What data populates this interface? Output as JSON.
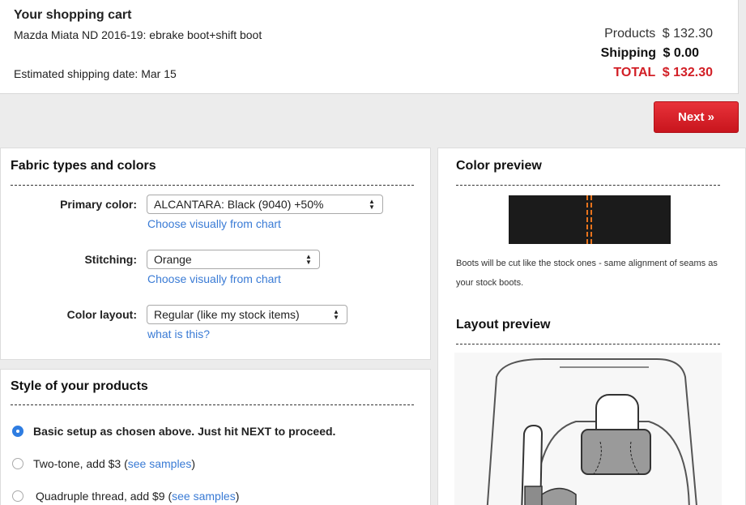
{
  "cart": {
    "title": "Your shopping cart",
    "product": "Mazda Miata ND 2016-19: ebrake boot+shift boot",
    "shipping_date": "Estimated shipping date: Mar 15",
    "products_label": "Products",
    "products_value": "$ 132.30",
    "shipping_label": "Shipping",
    "shipping_value": "$ 0.00",
    "total_label": "TOTAL",
    "total_value": "$ 132.30"
  },
  "next_button": "Next »",
  "fabric": {
    "title": "Fabric types and colors",
    "primary_label": "Primary color:",
    "primary_value": "ALCANTARA: Black (9040) +50%",
    "primary_link": "Choose visually from chart",
    "stitching_label": "Stitching:",
    "stitching_value": "Orange",
    "stitching_link": "Choose visually from chart",
    "layout_label": "Color layout:",
    "layout_value": "Regular (like my stock items)",
    "layout_link": "what is this?"
  },
  "style": {
    "title": "Style of your products",
    "options": [
      {
        "label": "Basic setup as chosen above. Just hit NEXT to proceed.",
        "checked": true
      },
      {
        "label": "Two-tone, add $3 (",
        "link": "see samples",
        "suffix": ")",
        "checked": false
      },
      {
        "label": "Quadruple thread, add $9 (",
        "link": "see samples",
        "suffix": ")",
        "checked": false
      }
    ]
  },
  "preview": {
    "color_title": "Color preview",
    "note": "Boots will be cut like the stock ones - same alignment of seams as your stock boots.",
    "layout_title": "Layout preview",
    "stitch_color": "#e8731c",
    "fabric_color": "#1b1b1b"
  },
  "colors": {
    "accent_red": "#d21f26",
    "link_blue": "#3a7bd5",
    "radio_blue": "#2f7de1"
  }
}
